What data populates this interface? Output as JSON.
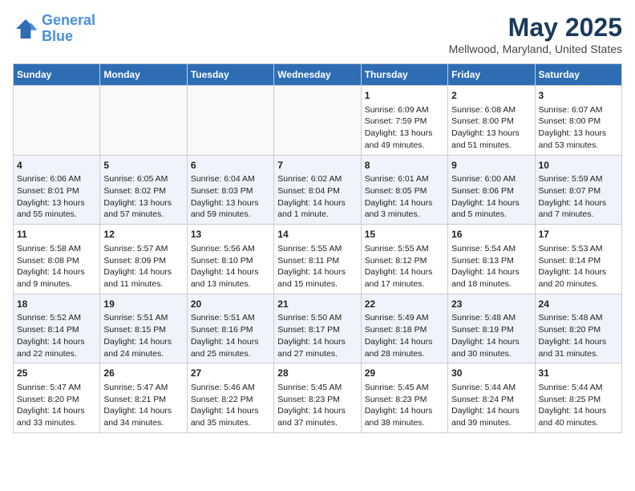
{
  "header": {
    "logo_line1": "General",
    "logo_line2": "Blue",
    "month": "May 2025",
    "location": "Mellwood, Maryland, United States"
  },
  "weekdays": [
    "Sunday",
    "Monday",
    "Tuesday",
    "Wednesday",
    "Thursday",
    "Friday",
    "Saturday"
  ],
  "weeks": [
    [
      {
        "day": "",
        "empty": true
      },
      {
        "day": "",
        "empty": true
      },
      {
        "day": "",
        "empty": true
      },
      {
        "day": "",
        "empty": true
      },
      {
        "day": "1",
        "sunrise": "6:09 AM",
        "sunset": "7:59 PM",
        "daylight": "13 hours and 49 minutes."
      },
      {
        "day": "2",
        "sunrise": "6:08 AM",
        "sunset": "8:00 PM",
        "daylight": "13 hours and 51 minutes."
      },
      {
        "day": "3",
        "sunrise": "6:07 AM",
        "sunset": "8:00 PM",
        "daylight": "13 hours and 53 minutes."
      }
    ],
    [
      {
        "day": "4",
        "sunrise": "6:06 AM",
        "sunset": "8:01 PM",
        "daylight": "13 hours and 55 minutes."
      },
      {
        "day": "5",
        "sunrise": "6:05 AM",
        "sunset": "8:02 PM",
        "daylight": "13 hours and 57 minutes."
      },
      {
        "day": "6",
        "sunrise": "6:04 AM",
        "sunset": "8:03 PM",
        "daylight": "13 hours and 59 minutes."
      },
      {
        "day": "7",
        "sunrise": "6:02 AM",
        "sunset": "8:04 PM",
        "daylight": "14 hours and 1 minute."
      },
      {
        "day": "8",
        "sunrise": "6:01 AM",
        "sunset": "8:05 PM",
        "daylight": "14 hours and 3 minutes."
      },
      {
        "day": "9",
        "sunrise": "6:00 AM",
        "sunset": "8:06 PM",
        "daylight": "14 hours and 5 minutes."
      },
      {
        "day": "10",
        "sunrise": "5:59 AM",
        "sunset": "8:07 PM",
        "daylight": "14 hours and 7 minutes."
      }
    ],
    [
      {
        "day": "11",
        "sunrise": "5:58 AM",
        "sunset": "8:08 PM",
        "daylight": "14 hours and 9 minutes."
      },
      {
        "day": "12",
        "sunrise": "5:57 AM",
        "sunset": "8:09 PM",
        "daylight": "14 hours and 11 minutes."
      },
      {
        "day": "13",
        "sunrise": "5:56 AM",
        "sunset": "8:10 PM",
        "daylight": "14 hours and 13 minutes."
      },
      {
        "day": "14",
        "sunrise": "5:55 AM",
        "sunset": "8:11 PM",
        "daylight": "14 hours and 15 minutes."
      },
      {
        "day": "15",
        "sunrise": "5:55 AM",
        "sunset": "8:12 PM",
        "daylight": "14 hours and 17 minutes."
      },
      {
        "day": "16",
        "sunrise": "5:54 AM",
        "sunset": "8:13 PM",
        "daylight": "14 hours and 18 minutes."
      },
      {
        "day": "17",
        "sunrise": "5:53 AM",
        "sunset": "8:14 PM",
        "daylight": "14 hours and 20 minutes."
      }
    ],
    [
      {
        "day": "18",
        "sunrise": "5:52 AM",
        "sunset": "8:14 PM",
        "daylight": "14 hours and 22 minutes."
      },
      {
        "day": "19",
        "sunrise": "5:51 AM",
        "sunset": "8:15 PM",
        "daylight": "14 hours and 24 minutes."
      },
      {
        "day": "20",
        "sunrise": "5:51 AM",
        "sunset": "8:16 PM",
        "daylight": "14 hours and 25 minutes."
      },
      {
        "day": "21",
        "sunrise": "5:50 AM",
        "sunset": "8:17 PM",
        "daylight": "14 hours and 27 minutes."
      },
      {
        "day": "22",
        "sunrise": "5:49 AM",
        "sunset": "8:18 PM",
        "daylight": "14 hours and 28 minutes."
      },
      {
        "day": "23",
        "sunrise": "5:48 AM",
        "sunset": "8:19 PM",
        "daylight": "14 hours and 30 minutes."
      },
      {
        "day": "24",
        "sunrise": "5:48 AM",
        "sunset": "8:20 PM",
        "daylight": "14 hours and 31 minutes."
      }
    ],
    [
      {
        "day": "25",
        "sunrise": "5:47 AM",
        "sunset": "8:20 PM",
        "daylight": "14 hours and 33 minutes."
      },
      {
        "day": "26",
        "sunrise": "5:47 AM",
        "sunset": "8:21 PM",
        "daylight": "14 hours and 34 minutes."
      },
      {
        "day": "27",
        "sunrise": "5:46 AM",
        "sunset": "8:22 PM",
        "daylight": "14 hours and 35 minutes."
      },
      {
        "day": "28",
        "sunrise": "5:45 AM",
        "sunset": "8:23 PM",
        "daylight": "14 hours and 37 minutes."
      },
      {
        "day": "29",
        "sunrise": "5:45 AM",
        "sunset": "8:23 PM",
        "daylight": "14 hours and 38 minutes."
      },
      {
        "day": "30",
        "sunrise": "5:44 AM",
        "sunset": "8:24 PM",
        "daylight": "14 hours and 39 minutes."
      },
      {
        "day": "31",
        "sunrise": "5:44 AM",
        "sunset": "8:25 PM",
        "daylight": "14 hours and 40 minutes."
      }
    ]
  ],
  "labels": {
    "sunrise": "Sunrise:",
    "sunset": "Sunset:",
    "daylight": "Daylight hours"
  }
}
